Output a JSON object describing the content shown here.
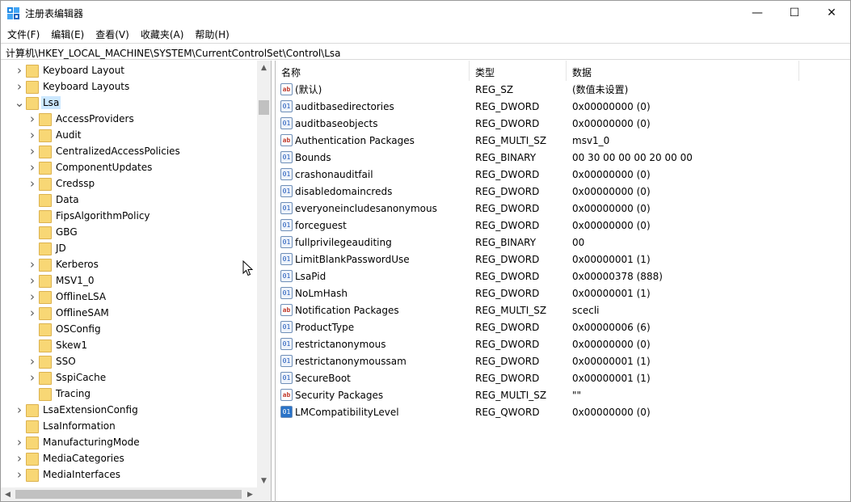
{
  "window": {
    "title": "注册表编辑器"
  },
  "controls": {
    "minimize": "—",
    "maximize": "☐",
    "close": "✕"
  },
  "menu": [
    "文件(F)",
    "编辑(E)",
    "查看(V)",
    "收藏夹(A)",
    "帮助(H)"
  ],
  "address": "计算机\\HKEY_LOCAL_MACHINE\\SYSTEM\\CurrentControlSet\\Control\\Lsa",
  "tree": [
    {
      "label": "Keyboard Layout",
      "level": 1,
      "arrow": "collapsed"
    },
    {
      "label": "Keyboard Layouts",
      "level": 1,
      "arrow": "collapsed"
    },
    {
      "label": "Lsa",
      "level": 1,
      "arrow": "expanded",
      "selected": true
    },
    {
      "label": "AccessProviders",
      "level": 2,
      "arrow": "collapsed"
    },
    {
      "label": "Audit",
      "level": 2,
      "arrow": "collapsed"
    },
    {
      "label": "CentralizedAccessPolicies",
      "level": 2,
      "arrow": "collapsed"
    },
    {
      "label": "ComponentUpdates",
      "level": 2,
      "arrow": "collapsed"
    },
    {
      "label": "Credssp",
      "level": 2,
      "arrow": "collapsed"
    },
    {
      "label": "Data",
      "level": 2,
      "arrow": "none"
    },
    {
      "label": "FipsAlgorithmPolicy",
      "level": 2,
      "arrow": "none"
    },
    {
      "label": "GBG",
      "level": 2,
      "arrow": "none"
    },
    {
      "label": "JD",
      "level": 2,
      "arrow": "none"
    },
    {
      "label": "Kerberos",
      "level": 2,
      "arrow": "collapsed"
    },
    {
      "label": "MSV1_0",
      "level": 2,
      "arrow": "collapsed"
    },
    {
      "label": "OfflineLSA",
      "level": 2,
      "arrow": "collapsed"
    },
    {
      "label": "OfflineSAM",
      "level": 2,
      "arrow": "collapsed"
    },
    {
      "label": "OSConfig",
      "level": 2,
      "arrow": "none"
    },
    {
      "label": "Skew1",
      "level": 2,
      "arrow": "none"
    },
    {
      "label": "SSO",
      "level": 2,
      "arrow": "collapsed"
    },
    {
      "label": "SspiCache",
      "level": 2,
      "arrow": "collapsed"
    },
    {
      "label": "Tracing",
      "level": 2,
      "arrow": "none"
    },
    {
      "label": "LsaExtensionConfig",
      "level": 1,
      "arrow": "collapsed"
    },
    {
      "label": "LsaInformation",
      "level": 1,
      "arrow": "none"
    },
    {
      "label": "ManufacturingMode",
      "level": 1,
      "arrow": "collapsed"
    },
    {
      "label": "MediaCategories",
      "level": 1,
      "arrow": "collapsed"
    },
    {
      "label": "MediaInterfaces",
      "level": 1,
      "arrow": "collapsed"
    }
  ],
  "columns": {
    "name": "名称",
    "type": "类型",
    "data": "数据"
  },
  "values": [
    {
      "icon": "string-value-icon",
      "name": "(默认)",
      "type": "REG_SZ",
      "data": "(数值未设置)"
    },
    {
      "icon": "binary-value-icon",
      "name": "auditbasedirectories",
      "type": "REG_DWORD",
      "data": "0x00000000 (0)"
    },
    {
      "icon": "binary-value-icon",
      "name": "auditbaseobjects",
      "type": "REG_DWORD",
      "data": "0x00000000 (0)"
    },
    {
      "icon": "string-value-icon",
      "name": "Authentication Packages",
      "type": "REG_MULTI_SZ",
      "data": "msv1_0"
    },
    {
      "icon": "binary-value-icon",
      "name": "Bounds",
      "type": "REG_BINARY",
      "data": "00 30 00 00 00 20 00 00"
    },
    {
      "icon": "binary-value-icon",
      "name": "crashonauditfail",
      "type": "REG_DWORD",
      "data": "0x00000000 (0)"
    },
    {
      "icon": "binary-value-icon",
      "name": "disabledomaincreds",
      "type": "REG_DWORD",
      "data": "0x00000000 (0)"
    },
    {
      "icon": "binary-value-icon",
      "name": "everyoneincludesanonymous",
      "type": "REG_DWORD",
      "data": "0x00000000 (0)"
    },
    {
      "icon": "binary-value-icon",
      "name": "forceguest",
      "type": "REG_DWORD",
      "data": "0x00000000 (0)"
    },
    {
      "icon": "binary-value-icon",
      "name": "fullprivilegeauditing",
      "type": "REG_BINARY",
      "data": "00"
    },
    {
      "icon": "binary-value-icon",
      "name": "LimitBlankPasswordUse",
      "type": "REG_DWORD",
      "data": "0x00000001 (1)"
    },
    {
      "icon": "binary-value-icon",
      "name": "LsaPid",
      "type": "REG_DWORD",
      "data": "0x00000378 (888)"
    },
    {
      "icon": "binary-value-icon",
      "name": "NoLmHash",
      "type": "REG_DWORD",
      "data": "0x00000001 (1)"
    },
    {
      "icon": "string-value-icon",
      "name": "Notification Packages",
      "type": "REG_MULTI_SZ",
      "data": "scecli"
    },
    {
      "icon": "binary-value-icon",
      "name": "ProductType",
      "type": "REG_DWORD",
      "data": "0x00000006 (6)"
    },
    {
      "icon": "binary-value-icon",
      "name": "restrictanonymous",
      "type": "REG_DWORD",
      "data": "0x00000000 (0)"
    },
    {
      "icon": "binary-value-icon",
      "name": "restrictanonymoussam",
      "type": "REG_DWORD",
      "data": "0x00000001 (1)"
    },
    {
      "icon": "binary-value-icon",
      "name": "SecureBoot",
      "type": "REG_DWORD",
      "data": "0x00000001 (1)"
    },
    {
      "icon": "string-value-icon",
      "name": "Security Packages",
      "type": "REG_MULTI_SZ",
      "data": "\"\""
    },
    {
      "icon": "qword-value-icon",
      "name": "LMCompatibilityLevel",
      "type": "REG_QWORD",
      "data": "0x00000000 (0)"
    }
  ],
  "colors": {
    "selection": "#cce8ff",
    "folder": "#f8d775",
    "scrollbar": "#f0f0f0"
  }
}
